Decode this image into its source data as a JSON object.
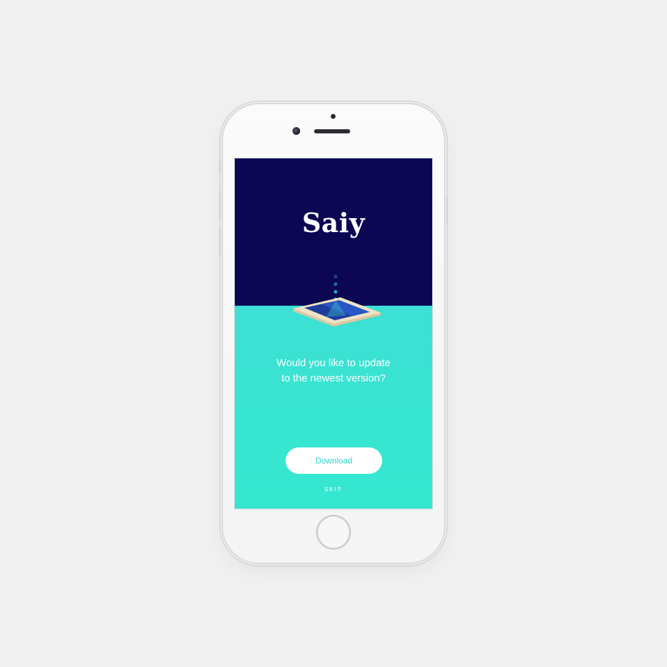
{
  "app": {
    "logo_text": "Saiy"
  },
  "prompt": {
    "line1": "Would you like to update",
    "line2": "to the newest version?"
  },
  "actions": {
    "download_label": "Download",
    "skip_label": "SKIP"
  },
  "colors": {
    "background": "#f0f0f0",
    "screen_top": "#0b0752",
    "screen_bottom": "#36e6d0",
    "button_text": "#2fd6c8",
    "white": "#ffffff"
  },
  "icons": {
    "illustration": "phone-update-illustration"
  }
}
